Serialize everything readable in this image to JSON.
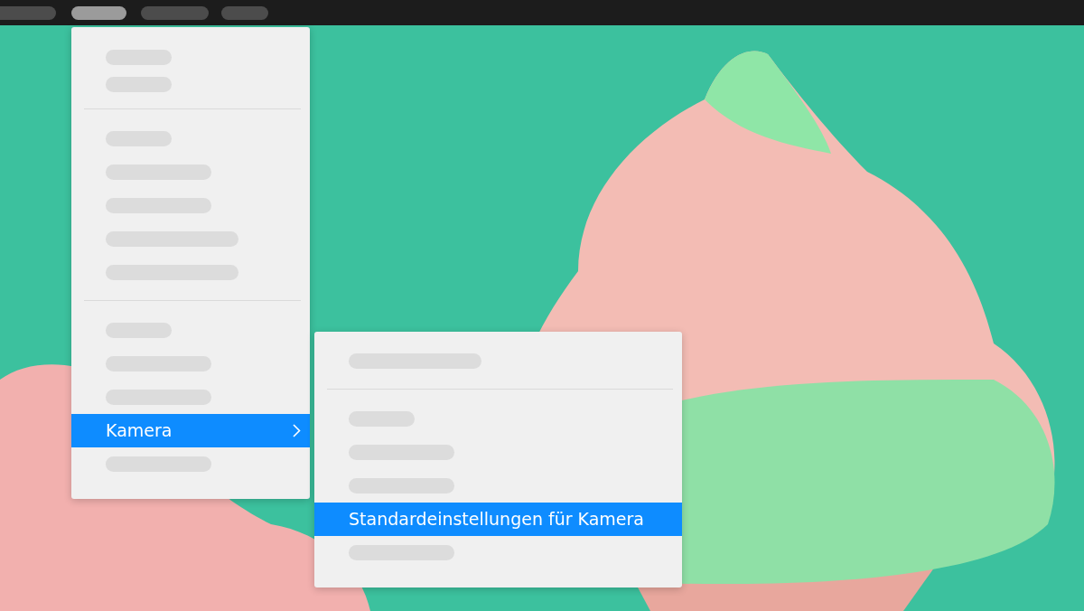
{
  "menu_bar": {
    "items": [
      {
        "selected": false
      },
      {
        "selected": true
      },
      {
        "selected": false
      },
      {
        "selected": false
      }
    ]
  },
  "menu": {
    "items": [
      {
        "kind": "short",
        "selected": false
      },
      {
        "kind": "short",
        "selected": false
      },
      {
        "kind": "separator"
      },
      {
        "kind": "short",
        "selected": false
      },
      {
        "kind": "medium",
        "selected": false
      },
      {
        "kind": "medium",
        "selected": false
      },
      {
        "kind": "long",
        "selected": false
      },
      {
        "kind": "long",
        "selected": false
      },
      {
        "kind": "separator"
      },
      {
        "kind": "short",
        "selected": false
      },
      {
        "kind": "medium",
        "selected": false
      },
      {
        "kind": "medium",
        "selected": false
      },
      {
        "kind": "item",
        "label": "Kamera",
        "selected": true,
        "has_submenu": true
      },
      {
        "kind": "medium",
        "selected": false
      }
    ]
  },
  "submenu": {
    "items": [
      {
        "kind": "long",
        "selected": false
      },
      {
        "kind": "separator"
      },
      {
        "kind": "short",
        "selected": false
      },
      {
        "kind": "medium",
        "selected": false
      },
      {
        "kind": "medium",
        "selected": false
      },
      {
        "kind": "item",
        "label": "Standardeinstellungen für Kamera",
        "selected": true
      },
      {
        "kind": "medium",
        "selected": false
      }
    ]
  }
}
